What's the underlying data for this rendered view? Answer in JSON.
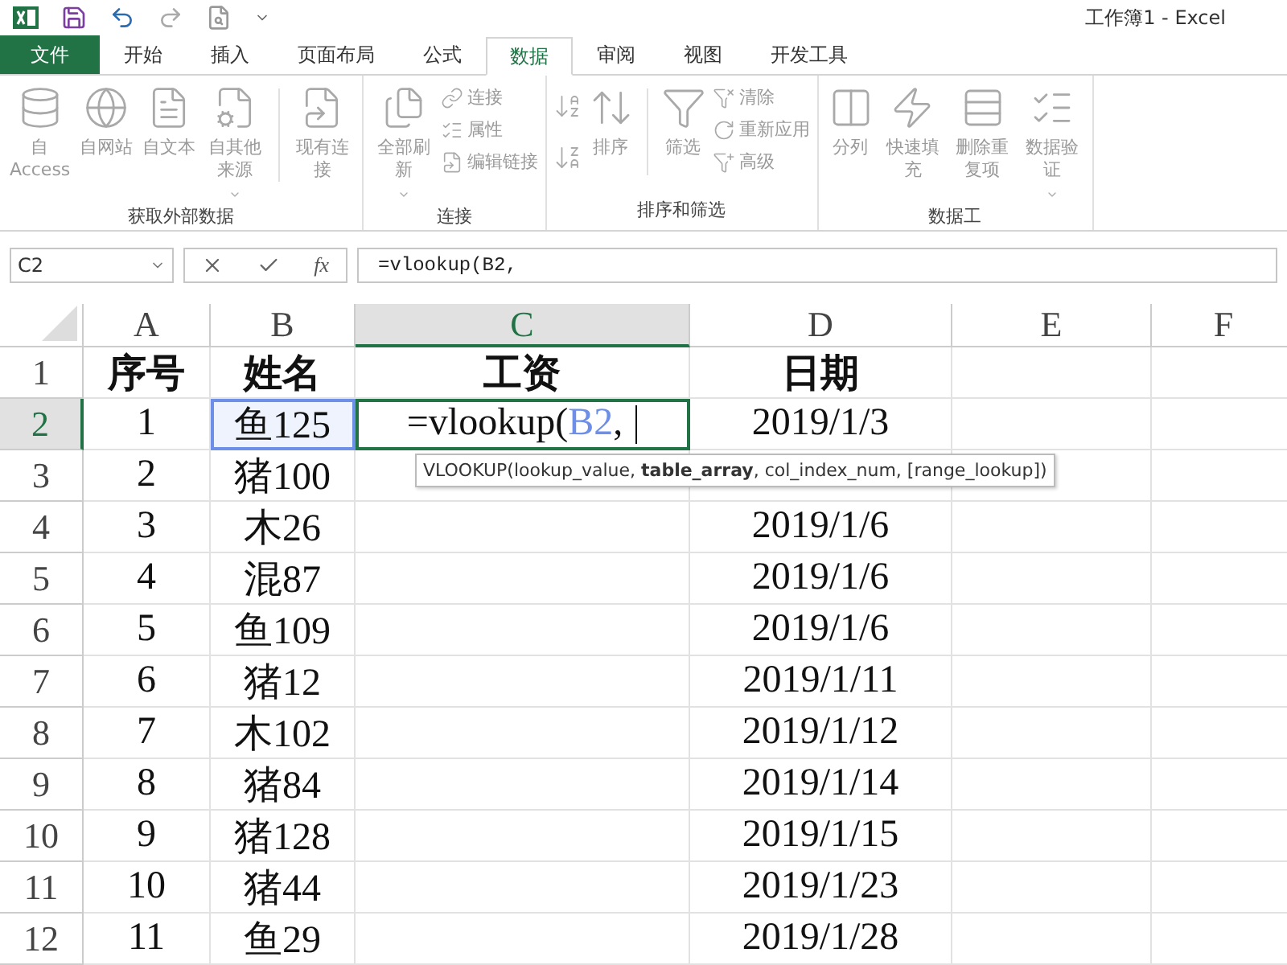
{
  "window": {
    "title": "工作簿1 - Excel"
  },
  "tabs": [
    {
      "label": "文件",
      "kind": "file",
      "selected": false
    },
    {
      "label": "开始",
      "kind": "tab",
      "selected": false
    },
    {
      "label": "插入",
      "kind": "tab",
      "selected": false
    },
    {
      "label": "页面布局",
      "kind": "tab",
      "selected": false
    },
    {
      "label": "公式",
      "kind": "tab",
      "selected": false
    },
    {
      "label": "数据",
      "kind": "tab",
      "selected": true
    },
    {
      "label": "审阅",
      "kind": "tab",
      "selected": false
    },
    {
      "label": "视图",
      "kind": "tab",
      "selected": false
    },
    {
      "label": "开发工具",
      "kind": "tab",
      "selected": false
    }
  ],
  "ribbon": [
    {
      "label": "获取外部数据",
      "items": [
        {
          "kind": "large",
          "label": "自 Access"
        },
        {
          "kind": "large",
          "label": "自网站"
        },
        {
          "kind": "large",
          "label": "自文本"
        },
        {
          "kind": "large",
          "label": "自其他来源",
          "dropdown": true
        },
        {
          "kind": "separator"
        },
        {
          "kind": "large",
          "label": "现有连接"
        }
      ]
    },
    {
      "label": "连接",
      "items": [
        {
          "kind": "large",
          "label": "全部刷新",
          "dropdown": true
        },
        {
          "kind": "stack",
          "items": [
            {
              "label": "连接"
            },
            {
              "label": "属性"
            },
            {
              "label": "编辑链接"
            }
          ]
        }
      ]
    },
    {
      "label": "排序和筛选",
      "items": [
        {
          "kind": "sort_buttons"
        },
        {
          "kind": "large",
          "label": "排序"
        },
        {
          "kind": "separator"
        },
        {
          "kind": "large",
          "label": "筛选"
        },
        {
          "kind": "stack",
          "items": [
            {
              "label": "清除"
            },
            {
              "label": "重新应用"
            },
            {
              "label": "高级"
            }
          ]
        }
      ]
    },
    {
      "label": "数据工",
      "items": [
        {
          "kind": "large",
          "label": "分列"
        },
        {
          "kind": "large",
          "label": "快速填充"
        },
        {
          "kind": "large",
          "label": "删除重复项"
        },
        {
          "kind": "large",
          "label": "数据验证",
          "dropdown": true
        }
      ]
    }
  ],
  "formula_bar": {
    "name_box": "C2",
    "function_button": "fx",
    "formula": "=vlookup(B2,"
  },
  "columns": [
    {
      "label": "A",
      "selected": false
    },
    {
      "label": "B",
      "selected": false
    },
    {
      "label": "C",
      "selected": true
    },
    {
      "label": "D",
      "selected": false
    },
    {
      "label": "E",
      "selected": false
    },
    {
      "label": "F",
      "selected": false
    }
  ],
  "rows": [
    {
      "number": "1",
      "selected": false,
      "header": true,
      "cells": [
        "序号",
        "姓名",
        "工资",
        "日期"
      ]
    },
    {
      "number": "2",
      "selected": true,
      "header": false,
      "cells": [
        "1",
        {
          "kind": "reference",
          "text": "鱼125"
        },
        {
          "kind": "editing",
          "before": "=vlookup(",
          "reference": "B2",
          "after": ","
        },
        "2019/1/3"
      ]
    },
    {
      "number": "3",
      "selected": false,
      "header": false,
      "cells": [
        "2",
        "猪100",
        "",
        ""
      ]
    },
    {
      "number": "4",
      "selected": false,
      "header": false,
      "cells": [
        "3",
        "木26",
        "",
        "2019/1/6"
      ]
    },
    {
      "number": "5",
      "selected": false,
      "header": false,
      "cells": [
        "4",
        "混87",
        "",
        "2019/1/6"
      ]
    },
    {
      "number": "6",
      "selected": false,
      "header": false,
      "cells": [
        "5",
        "鱼109",
        "",
        "2019/1/6"
      ]
    },
    {
      "number": "7",
      "selected": false,
      "header": false,
      "cells": [
        "6",
        "猪12",
        "",
        "2019/1/11"
      ]
    },
    {
      "number": "8",
      "selected": false,
      "header": false,
      "cells": [
        "7",
        "木102",
        "",
        "2019/1/12"
      ]
    },
    {
      "number": "9",
      "selected": false,
      "header": false,
      "cells": [
        "8",
        "猪84",
        "",
        "2019/1/14"
      ]
    },
    {
      "number": "10",
      "selected": false,
      "header": false,
      "cells": [
        "9",
        "猪128",
        "",
        "2019/1/15"
      ]
    },
    {
      "number": "11",
      "selected": false,
      "header": false,
      "cells": [
        "10",
        "猪44",
        "",
        "2019/1/23"
      ]
    },
    {
      "number": "12",
      "selected": false,
      "header": false,
      "cells": [
        "11",
        "鱼29",
        "",
        "2019/1/28"
      ]
    }
  ],
  "tooltip": "VLOOKUP(lookup_value, **table_array**, col_index_num, [range_lookup])"
}
